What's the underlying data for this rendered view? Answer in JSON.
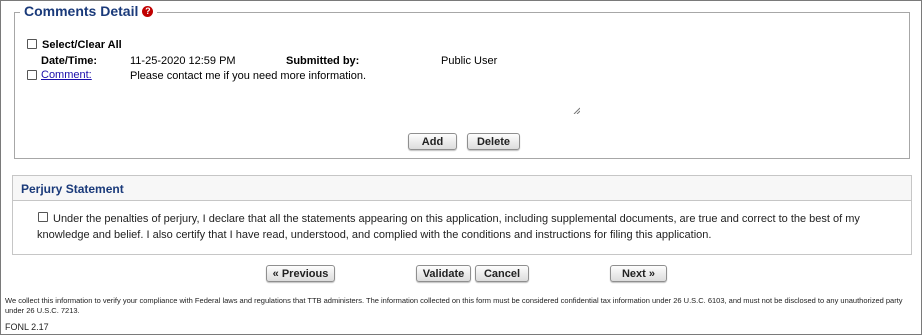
{
  "comments": {
    "title": "Comments Detail",
    "help_icon": "?",
    "select_all_label": "Select/Clear All",
    "date_time_label": "Date/Time:",
    "date_time_value": "11-25-2020 12:59 PM",
    "submitted_by_label": "Submitted by:",
    "submitted_by_value": "Public User",
    "comment_link": "Comment:",
    "comment_text": "Please contact me if you need more information.",
    "add_button": "Add",
    "delete_button": "Delete"
  },
  "perjury": {
    "title": "Perjury Statement",
    "statement": "Under the penalties of perjury, I declare that all the statements appearing on this application, including supplemental documents, are true and correct to the best of my knowledge and belief. I also certify that I have read, understood, and complied with the conditions and instructions for filing this application."
  },
  "navigation": {
    "previous": "« Previous",
    "validate": "Validate",
    "cancel": "Cancel",
    "next": "Next »"
  },
  "footer": {
    "notice": "We collect this information to verify your compliance with Federal laws and regulations that TTB administers. The information collected on this form must be considered confidential tax information under 26 U.S.C. 6103, and must not be disclosed to any unauthorized party under 26 U.S.C. 7213.",
    "version": "FONL 2.17"
  },
  "colors": {
    "heading": "#1a3a7a",
    "help_icon": "#c00000",
    "link": "#1a0dab"
  }
}
